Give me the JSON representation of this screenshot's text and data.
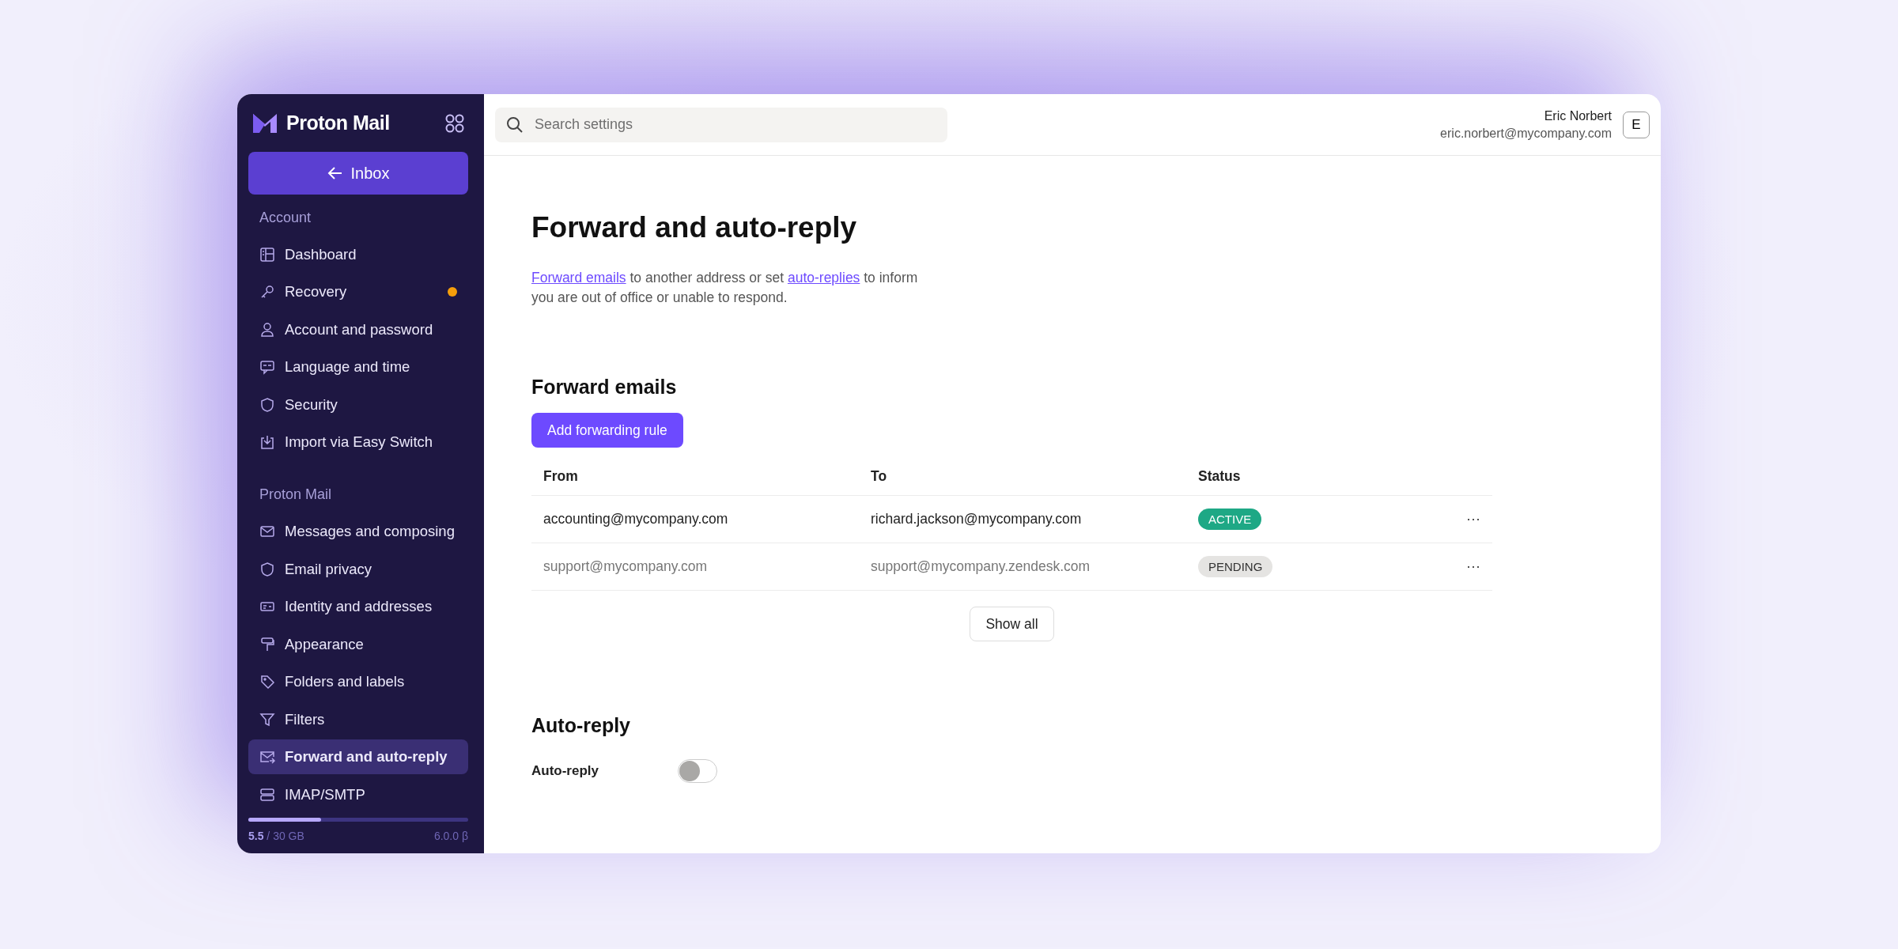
{
  "sidebar": {
    "brand": "Proton Mail",
    "inbox_button": "Inbox",
    "sections": [
      {
        "title": "Account",
        "items": [
          {
            "label": "Dashboard",
            "selected": false
          },
          {
            "label": "Recovery",
            "selected": false,
            "color": "#f59e0b"
          },
          {
            "label": "Account and password",
            "selected": false
          },
          {
            "label": "Language and time",
            "selected": false
          },
          {
            "label": "Security",
            "selected": false
          },
          {
            "label": "Import via Easy Switch",
            "selected": false
          }
        ]
      },
      {
        "title": "Proton Mail",
        "items": [
          {
            "label": "Messages and composing",
            "selected": false
          },
          {
            "label": "Email privacy",
            "selected": false
          },
          {
            "label": "Identity and addresses",
            "selected": false
          },
          {
            "label": "Appearance",
            "selected": false
          },
          {
            "label": "Folders and labels",
            "selected": false
          },
          {
            "label": "Filters",
            "selected": false
          },
          {
            "label": "Forward and auto-reply",
            "selected": true
          },
          {
            "label": "IMAP/SMTP",
            "selected": false
          }
        ]
      }
    ],
    "storage": {
      "level": 0.33,
      "text": "**5.5** / 30 GB",
      "version": "6.0.0 β"
    }
  },
  "topbar": {
    "search": {
      "placeholder": "Search settings"
    },
    "user": {
      "name": "Eric Norbert",
      "email": "eric.norbert@mycompany.com",
      "initial": "E"
    }
  },
  "page": {
    "title": "Forward and auto-reply",
    "description": [
      {
        "text": "Forward emails",
        "kind": "link"
      },
      {
        "text": " to another address or set ",
        "kind": "text"
      },
      {
        "text": "auto-replies",
        "kind": "link"
      },
      {
        "text": " to inform you are out of office or unable to respond.",
        "kind": "text"
      }
    ],
    "forward": {
      "heading": "Forward emails",
      "add_button": "Add forwarding rule",
      "table": {
        "columns": [
          "From",
          "To",
          "Status"
        ],
        "rows": [
          {
            "from": "accounting@mycompany.com",
            "to": "richard.jackson@mycompany.com",
            "status": "ACTIVE",
            "kind": "active",
            "menu": "···"
          },
          {
            "from": "support@mycompany.com",
            "to": "support@mycompany.zendesk.com",
            "status": "PENDING",
            "kind": "pending",
            "menu": "···"
          }
        ]
      },
      "show_all": "Show all"
    },
    "auto_reply": {
      "heading": "Auto-reply",
      "label": "Auto-reply",
      "on": false
    }
  }
}
